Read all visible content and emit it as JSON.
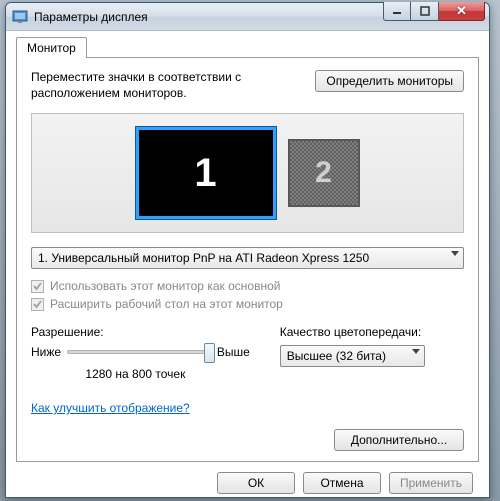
{
  "window": {
    "title": "Параметры дисплея"
  },
  "tabs": {
    "monitor": "Монитор"
  },
  "panel": {
    "instruction": "Переместите значки в соответствии с расположением мониторов.",
    "identify_btn": "Определить мониторы",
    "monitor1_num": "1",
    "monitor2_num": "2",
    "monitor_dropdown": "1. Универсальный монитор PnP на ATI Radeon Xpress 1250",
    "use_primary": "Использовать этот монитор как основной",
    "extend_desktop": "Расширить рабочий стол на этот монитор",
    "resolution_label": "Разрешение:",
    "slider_low": "Ниже",
    "slider_high": "Выше",
    "resolution_value": "1280 на 800 точек",
    "quality_label": "Качество цветопередачи:",
    "quality_value": "Высшее (32 бита)",
    "help_link": "Как улучшить отображение?",
    "advanced_btn": "Дополнительно..."
  },
  "buttons": {
    "ok": "ОК",
    "cancel": "Отмена",
    "apply": "Применить"
  }
}
